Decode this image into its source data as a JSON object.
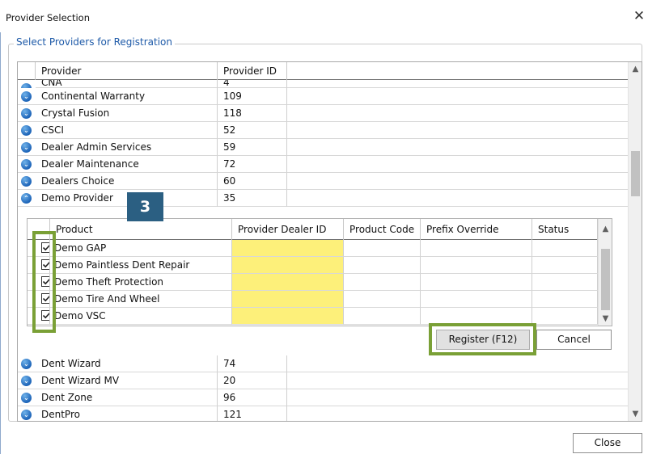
{
  "window": {
    "title": "Provider Selection",
    "close_glyph": "✕"
  },
  "group": {
    "legend": "Select Providers for Registration"
  },
  "grid": {
    "columns": [
      "Provider",
      "Provider ID"
    ],
    "rows_above": [
      {
        "provider": "CNA",
        "id": "4"
      },
      {
        "provider": "Continental Warranty",
        "id": "109"
      },
      {
        "provider": "Crystal Fusion",
        "id": "118"
      },
      {
        "provider": "CSCI",
        "id": "52"
      },
      {
        "provider": "Dealer Admin Services",
        "id": "59"
      },
      {
        "provider": "Dealer Maintenance",
        "id": "72"
      },
      {
        "provider": "Dealers Choice",
        "id": "60"
      },
      {
        "provider": "Demo Provider",
        "id": "35"
      }
    ],
    "rows_below": [
      {
        "provider": "Dent Wizard",
        "id": "74"
      },
      {
        "provider": "Dent Wizard MV",
        "id": "20"
      },
      {
        "provider": "Dent Zone",
        "id": "96"
      },
      {
        "provider": "DentPro",
        "id": "121"
      }
    ]
  },
  "detail": {
    "columns": [
      "Product",
      "Provider Dealer ID",
      "Product Code",
      "Prefix Override",
      "Status"
    ],
    "products": [
      {
        "name": "Demo GAP",
        "checked": true,
        "dealer_id": "",
        "code": "",
        "prefix": "",
        "status": ""
      },
      {
        "name": "Demo Paintless Dent Repair",
        "checked": true,
        "dealer_id": "",
        "code": "",
        "prefix": "",
        "status": ""
      },
      {
        "name": "Demo Theft Protection",
        "checked": true,
        "dealer_id": "",
        "code": "",
        "prefix": "",
        "status": ""
      },
      {
        "name": "Demo Tire And Wheel",
        "checked": true,
        "dealer_id": "",
        "code": "",
        "prefix": "",
        "status": ""
      },
      {
        "name": "Demo VSC",
        "checked": true,
        "dealer_id": "",
        "code": "",
        "prefix": "",
        "status": ""
      }
    ]
  },
  "buttons": {
    "register": "Register (F12)",
    "cancel": "Cancel",
    "close": "Close"
  },
  "callout": {
    "number": "3"
  },
  "colors": {
    "highlight": "#7aa036",
    "callout_bg": "#2b5f82",
    "dealer_id_fill": "#fdf07a",
    "legend": "#1e5aa8"
  },
  "icons": {
    "expand": "expand-chevron-icon",
    "collapse": "collapse-chevron-icon",
    "scroll_up": "▲",
    "scroll_down": "▼"
  }
}
